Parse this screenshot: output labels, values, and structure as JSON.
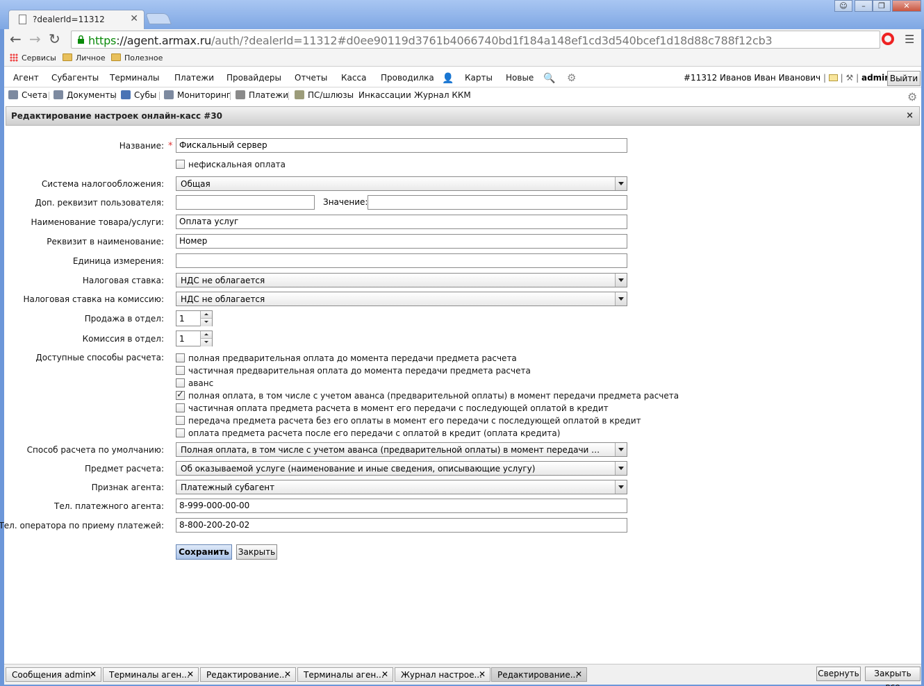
{
  "browser": {
    "tab_title": "?dealerId=11312",
    "tab_close": "✕",
    "url_scheme": "https",
    "url_host": "://agent.armax.ru",
    "url_rest": "/auth/?dealerId=11312#d0ee90119d3761b4066740bd1f184a148ef1cd3d540bcef1d18d88c788f12cb3",
    "bookmarks": [
      "Сервисы",
      "Личное",
      "Полезное"
    ]
  },
  "menu1": {
    "items": [
      "Агент",
      "Субагенты",
      "Терминалы",
      "Платежи",
      "Провайдеры",
      "Отчеты",
      "Касса",
      "Проводилка",
      "Карты",
      "Новые"
    ],
    "user": "#11312 Иванов Иван Иванович",
    "admin": "admin",
    "logout": "Выйти"
  },
  "menu2": {
    "items": [
      "Счета",
      "Документы",
      "Субы",
      "Мониторинг",
      "Платежи",
      "ПС/шлюзы",
      "Инкассации",
      "Журнал ККМ"
    ]
  },
  "panel": {
    "title": "Редактирование настроек онлайн-касс #30",
    "close": "×"
  },
  "form": {
    "name_label": "Название:",
    "name_value": "Фискальный сервер",
    "nonfiscal_label": "нефискальная оплата",
    "tax_system_label": "Система налогообложения:",
    "tax_system_value": "Общая",
    "user_req_label": "Доп. реквизит пользователя:",
    "user_req_value": "",
    "value_label": "Значение:",
    "value_value": "",
    "goods_name_label": "Наименование товара/услуги:",
    "goods_name_value": "Оплата услуг",
    "req_in_name_label": "Реквизит в наименование:",
    "req_in_name_value": "Номер",
    "unit_label": "Единица измерения:",
    "unit_value": "",
    "tax_rate_label": "Налоговая ставка:",
    "tax_rate_value": "НДС не облагается",
    "tax_rate_comm_label": "Налоговая ставка на комиссию:",
    "tax_rate_comm_value": "НДС не облагается",
    "sale_dept_label": "Продажа в отдел:",
    "sale_dept_value": "1",
    "comm_dept_label": "Комиссия в отдел:",
    "comm_dept_value": "1",
    "payment_methods_label": "Доступные способы расчета:",
    "payment_methods": [
      {
        "label": "полная предварительная оплата до момента передачи предмета расчета",
        "checked": false
      },
      {
        "label": "частичная предварительная оплата до момента передачи предмета расчета",
        "checked": false
      },
      {
        "label": "аванс",
        "checked": false
      },
      {
        "label": "полная оплата, в том числе с учетом аванса (предварительной оплаты) в момент передачи предмета расчета",
        "checked": true
      },
      {
        "label": "частичная оплата предмета расчета в момент его передачи с последующей оплатой в кредит",
        "checked": false
      },
      {
        "label": "передача предмета расчета без его оплаты в момент его передачи с последующей оплатой в кредит",
        "checked": false
      },
      {
        "label": "оплата предмета расчета после его передачи с оплатой в кредит (оплата кредита)",
        "checked": false
      }
    ],
    "default_method_label": "Способ расчета по умолчанию:",
    "default_method_value": "Полная оплата, в том числе с учетом аванса (предварительной оплаты) в момент передачи предмета расчета",
    "subject_label": "Предмет расчета:",
    "subject_value": "Об оказываемой услуге (наименование и иные сведения, описывающие услугу)",
    "agent_sign_label": "Признак агента:",
    "agent_sign_value": "Платежный субагент",
    "agent_phone_label": "Тел. платежного агента:",
    "agent_phone_value": "8-999-000-00-00",
    "operator_phone_label": "Тел. оператора по приему платежей:",
    "operator_phone_value": "8-800-200-20-02",
    "save": "Сохранить",
    "close": "Закрыть"
  },
  "taskbar": {
    "tasks": [
      "Сообщения admin",
      "Терминалы аген...",
      "Редактирование...",
      "Терминалы аген...",
      "Журнал настрое...",
      "Редактирование..."
    ],
    "close_mark": "✕",
    "collapse": "Свернуть",
    "close_all": "Закрыть все"
  }
}
